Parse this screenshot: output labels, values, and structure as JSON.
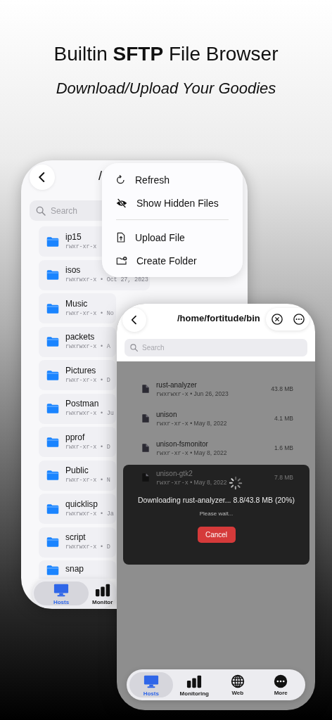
{
  "headline": "Builtin **SFTP** File Browser",
  "subheadline": "Download/Upload Your Goodies",
  "back_screen": {
    "title": "/",
    "search": {
      "placeholder": "Search"
    },
    "items": [
      {
        "name": "ip15",
        "meta": "rwxr-xr-x"
      },
      {
        "name": "isos",
        "meta": "rwxrwxr-x • Oct 27, 2023"
      },
      {
        "name": "Music",
        "meta": "rwxr-xr-x • No"
      },
      {
        "name": "packets",
        "meta": "rwxrwxr-x • A"
      },
      {
        "name": "Pictures",
        "meta": "rwxr-xr-x • D"
      },
      {
        "name": "Postman",
        "meta": "rwxrwxr-x • Ju"
      },
      {
        "name": "pprof",
        "meta": "rwxr-xr-x • D"
      },
      {
        "name": "Public",
        "meta": "rwxr-xr-x • N"
      },
      {
        "name": "quicklisp",
        "meta": "rwxrwxr-x • Ja"
      },
      {
        "name": "script",
        "meta": "rwxrwxr-x • D"
      },
      {
        "name": "snap"
      }
    ],
    "tab_bar": [
      {
        "label": "Hosts",
        "kind": "monitor",
        "selected": true
      },
      {
        "label": "Monitor",
        "kind": "bars",
        "selected": false
      }
    ]
  },
  "menu": {
    "sections": [
      [
        {
          "label": "Refresh",
          "kind": "refresh"
        },
        {
          "label": "Show Hidden Files",
          "kind": "eye"
        }
      ],
      [
        {
          "label": "Upload File",
          "kind": "upload"
        },
        {
          "label": "Create Folder",
          "kind": "folder"
        }
      ]
    ]
  },
  "front_screen": {
    "title": "/home/fortitude/bin",
    "search": {
      "placeholder": "Search"
    },
    "files": [
      {
        "name": "rust-analyzer",
        "meta": "rwxrwxr-x • Jun 26, 2023",
        "size": "43.8 MB"
      },
      {
        "name": "unison",
        "meta": "rwxr-xr-x • May 8, 2022",
        "size": "4.1 MB"
      },
      {
        "name": "unison-fsmonitor",
        "meta": "rwxr-xr-x • May 8, 2022",
        "size": "1.6 MB"
      },
      {
        "name": "unison-gtk2",
        "meta": "rwxr-xr-x • May 8, 2022",
        "size": "7.8 MB"
      }
    ],
    "dialog": {
      "message": "Downloading rust-analyzer... 8.8/43.8 MB (20%)",
      "note": "Please wait...",
      "button": "Cancel"
    },
    "tab_bar": [
      {
        "label": "Hosts",
        "kind": "monitor",
        "selected": true
      },
      {
        "label": "Monitoring",
        "kind": "bars",
        "selected": false
      },
      {
        "label": "Web",
        "kind": "globe",
        "selected": false
      },
      {
        "label": "More",
        "kind": "more",
        "selected": false
      }
    ]
  }
}
